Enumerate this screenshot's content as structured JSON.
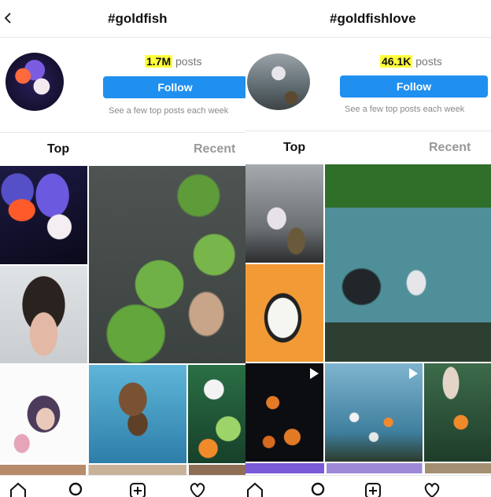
{
  "left": {
    "header": {
      "title": "#goldfish",
      "back_icon": "chevron-left-icon"
    },
    "stats": {
      "count": "1.7M",
      "label": " posts"
    },
    "follow_button": "Follow",
    "subtitle": "See a few top posts each week",
    "tabs": [
      {
        "label": "Top",
        "active": true
      },
      {
        "label": "Recent",
        "active": false
      }
    ],
    "grid_items": [
      "goldfish-photo",
      "hand-plants-video",
      "selfie-photo",
      "illustration-photo",
      "oranda-aquarium-photo",
      "goldfish-tank-photo",
      "partial-row"
    ]
  },
  "right": {
    "header": {
      "title": "#goldfishlove"
    },
    "stats": {
      "count": "46.1K",
      "label": " posts"
    },
    "follow_button": "Follow",
    "subtitle": "See a few top posts each week",
    "tabs": [
      {
        "label": "Top",
        "active": true
      },
      {
        "label": "Recent",
        "active": false
      }
    ],
    "grid_items": [
      "goldfish-photo",
      "aquarium-video",
      "illustration-photo",
      "goldfish-dark-video",
      "aquarium-video-2",
      "aquarium-photo",
      "partial-row"
    ]
  },
  "bottom_nav": [
    "home-icon",
    "search-icon",
    "add-post-icon",
    "heart-icon"
  ],
  "colors": {
    "follow": "#1f8ff0",
    "highlight": "#ffff3a",
    "muted": "#999999"
  }
}
